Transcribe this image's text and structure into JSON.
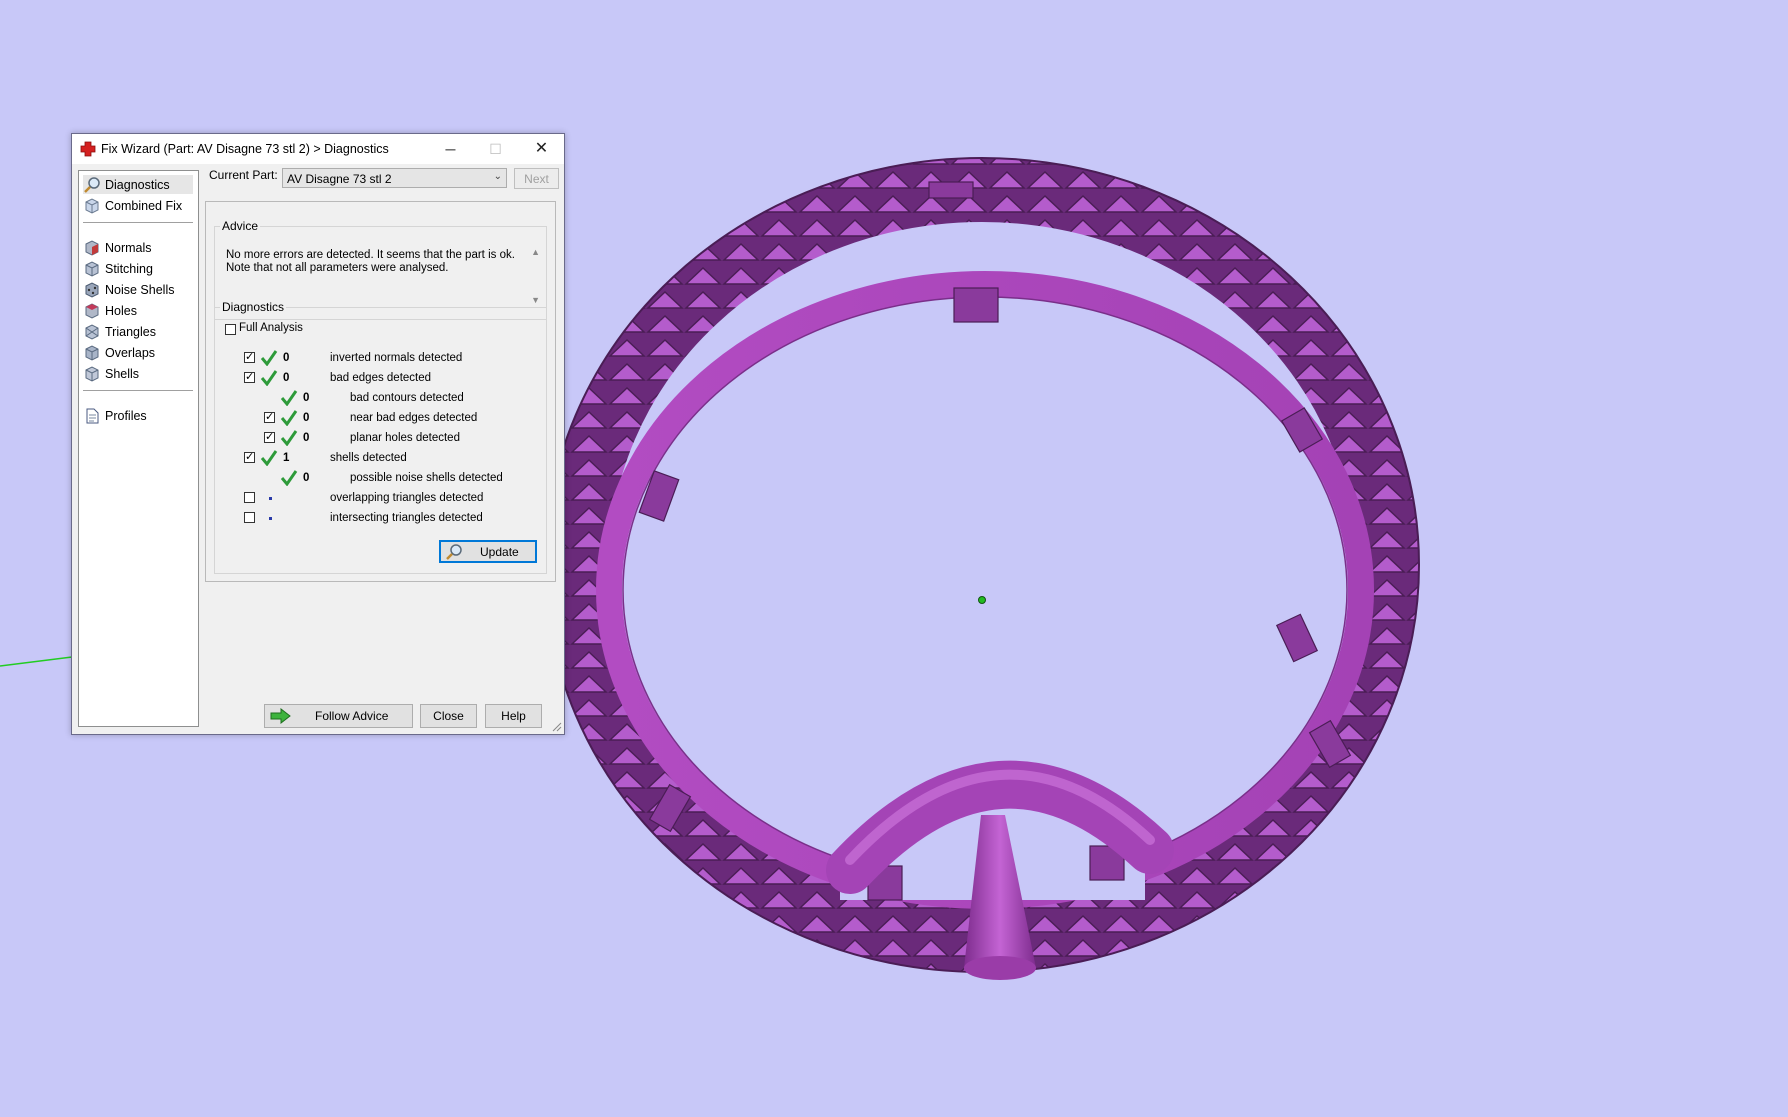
{
  "window": {
    "title": "Fix Wizard (Part: AV Disagne 73 stl 2) > Diagnostics",
    "minimize_glyph": "─",
    "maximize_glyph": "☐",
    "close_glyph": "✕"
  },
  "sidebar": {
    "items": [
      {
        "label": "Diagnostics",
        "icon": "magnifier-icon",
        "selected": true
      },
      {
        "label": "Combined Fix",
        "icon": "cube-icon"
      },
      {
        "label": "Normals",
        "icon": "normals-cube-icon"
      },
      {
        "label": "Stitching",
        "icon": "stitching-cube-icon"
      },
      {
        "label": "Noise Shells",
        "icon": "noise-shells-icon"
      },
      {
        "label": "Holes",
        "icon": "holes-cube-icon"
      },
      {
        "label": "Triangles",
        "icon": "triangles-cube-icon"
      },
      {
        "label": "Overlaps",
        "icon": "overlaps-cube-icon"
      },
      {
        "label": "Shells",
        "icon": "shells-cube-icon"
      },
      {
        "label": "Profiles",
        "icon": "document-icon"
      }
    ]
  },
  "current_part": {
    "label": "Current Part:",
    "value": "AV Disagne 73 stl 2",
    "next_label": "Next"
  },
  "advice": {
    "title": "Advice",
    "text": "No more errors are detected. It seems that the part is ok. Note that not all parameters were analysed."
  },
  "diagnostics": {
    "title": "Diagnostics",
    "full_analysis_label": "Full Analysis",
    "full_analysis_checked": false,
    "rows": [
      {
        "checked": true,
        "status": "ok",
        "count": "0",
        "label": "inverted normals detected",
        "indent": 0
      },
      {
        "checked": true,
        "status": "ok",
        "count": "0",
        "label": "bad edges detected",
        "indent": 0
      },
      {
        "checked": null,
        "status": "ok",
        "count": "0",
        "label": "bad contours detected",
        "indent": 1
      },
      {
        "checked": true,
        "status": "ok",
        "count": "0",
        "label": "near bad edges detected",
        "indent": 1
      },
      {
        "checked": true,
        "status": "ok",
        "count": "0",
        "label": "planar holes detected",
        "indent": 1
      },
      {
        "checked": true,
        "status": "ok",
        "count": "1",
        "label": "shells detected",
        "indent": 0
      },
      {
        "checked": null,
        "status": "ok",
        "count": "0",
        "label": "possible noise shells detected",
        "indent": 1
      },
      {
        "checked": false,
        "status": "not-run",
        "count": "",
        "label": "overlapping triangles detected",
        "indent": 0
      },
      {
        "checked": false,
        "status": "not-run",
        "count": "",
        "label": "intersecting triangles detected",
        "indent": 0
      }
    ],
    "update_label": "Update"
  },
  "footer": {
    "follow_advice_label": "Follow Advice",
    "close_label": "Close",
    "help_label": "Help"
  },
  "colors": {
    "viewport_bg": "#c8c8f8",
    "model_purple": "#9a3ca8",
    "check_green": "#2e9b3a"
  }
}
